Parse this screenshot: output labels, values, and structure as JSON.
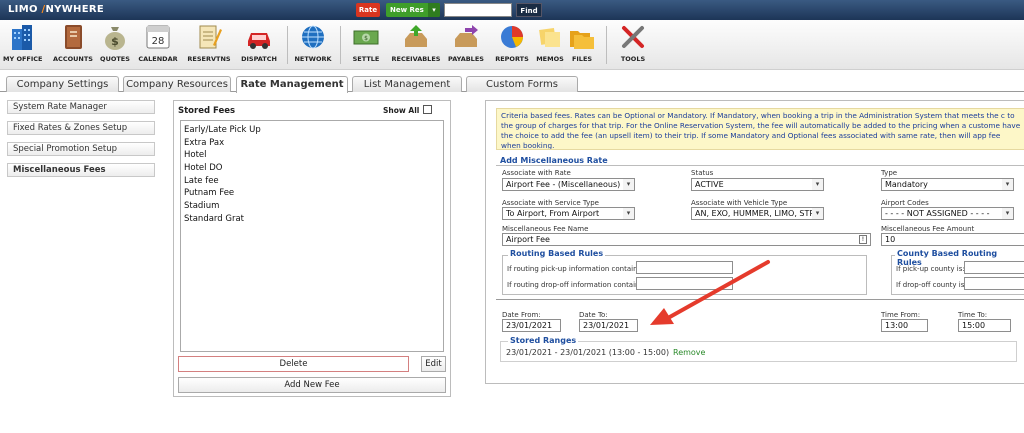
{
  "app": {
    "logo_text_a": "LIMO",
    "logo_text_b": "NYWHERE",
    "rate_label": "Rate",
    "new_res_label": "New Res",
    "new_res_caret": "▾",
    "search_value": "",
    "find_label": "Find"
  },
  "toolbar": {
    "items": [
      {
        "label": "MY OFFICE",
        "icon": "building-icon"
      },
      {
        "label": "ACCOUNTS",
        "icon": "ledger-book-icon"
      },
      {
        "label": "QUOTES",
        "icon": "money-bag-icon"
      },
      {
        "label": "CALENDAR",
        "icon": "calendar-icon"
      },
      {
        "label": "RESERVTNS",
        "icon": "notepad-pencil-icon"
      },
      {
        "label": "DISPATCH",
        "icon": "car-icon"
      },
      {
        "label": "NETWORK",
        "icon": "globe-icon"
      },
      {
        "label": "SETTLE",
        "icon": "cash-icon"
      },
      {
        "label": "RECEIVABLES",
        "icon": "inbox-tray-icon"
      },
      {
        "label": "PAYABLES",
        "icon": "outbox-tray-icon"
      },
      {
        "label": "REPORTS",
        "icon": "pie-chart-icon"
      },
      {
        "label": "MEMOS",
        "icon": "sticky-notes-icon"
      },
      {
        "label": "FILES",
        "icon": "folders-icon"
      },
      {
        "label": "TOOLS",
        "icon": "wrench-screwdriver-icon"
      }
    ],
    "calendar_day": "28"
  },
  "tabs": [
    {
      "label": "Company Settings",
      "active": false
    },
    {
      "label": "Company Resources",
      "active": false
    },
    {
      "label": "Rate Management",
      "active": true
    },
    {
      "label": "List Management",
      "active": false
    },
    {
      "label": "Custom Forms",
      "active": false
    }
  ],
  "nav": {
    "items": [
      {
        "label": "System Rate Manager",
        "active": false
      },
      {
        "label": "Fixed Rates & Zones Setup",
        "active": false
      },
      {
        "label": "Special Promotion Setup",
        "active": false
      },
      {
        "label": "Miscellaneous Fees",
        "active": true
      }
    ]
  },
  "stored_fees": {
    "title": "Stored Fees",
    "show_all_label": "Show All",
    "items": [
      "Early/Late Pick Up",
      "Extra Pax",
      "Hotel",
      "Hotel DO",
      "Late fee",
      "Putnam Fee",
      "Stadium",
      "Standard Grat"
    ],
    "delete_label": "Delete",
    "edit_label": "Edit",
    "add_label": "Add New Fee"
  },
  "criteria": {
    "text": "Criteria based fees. Rates can be Optional or Mandatory. If Mandatory, when booking a trip in the Administration System that meets the c to the group of charges for that trip. For the Online Reservation System, the fee will automatically be added to the pricing when a custome have the choice to add the fee (an upsell item) to their trip. If some Mandatory and Optional fees associated with same rate, then will app fee when booking."
  },
  "form": {
    "title": "Add Miscellaneous Rate",
    "associate_rate_label": "Associate with Rate",
    "associate_rate_value": "Airport Fee - (Miscellaneous)",
    "status_label": "Status",
    "status_value": "ACTIVE",
    "type_label": "Type",
    "type_value": "Mandatory",
    "service_type_label": "Associate with Service Type",
    "service_type_value": "To Airport, From Airport",
    "vehicle_type_label": "Associate with Vehicle Type",
    "vehicle_type_value": "AN, EXO, HUMMER, LIMO, STR",
    "airport_codes_label": "Airport Codes",
    "airport_codes_value": "- - - - NOT ASSIGNED - - - -",
    "fee_name_label": "Miscellaneous Fee Name",
    "fee_name_value": "Airport Fee",
    "fee_amount_label": "Miscellaneous Fee Amount",
    "fee_amount_value": "10",
    "routing_title": "Routing Based Rules",
    "routing_pickup_label": "If routing pick-up information contains:",
    "routing_dropoff_label": "If routing drop-off information contains:",
    "routing_pickup_value": "",
    "routing_dropoff_value": "",
    "county_title": "County Based Routing Rules",
    "county_pickup_label": "If pick-up county is:",
    "county_dropoff_label": "If drop-off county is:",
    "county_pickup_value": "",
    "county_dropoff_value": "",
    "date_from_label": "Date From:",
    "date_from_value": "23/01/2021",
    "date_to_label": "Date To:",
    "date_to_value": "23/01/2021",
    "time_from_label": "Time From:",
    "time_from_value": "13:00",
    "time_to_label": "Time To:",
    "time_to_value": "15:00",
    "stored_ranges_title": "Stored Ranges",
    "stored_range_value": "23/01/2021 - 23/01/2021 (13:00 - 15:00)",
    "stored_range_remove": "Remove"
  },
  "colors": {
    "accent_red": "#d9351f",
    "accent_green": "#3f9e2a",
    "link_blue": "#1f4fa0",
    "criteria_bg": "#fdf7c8",
    "arrow_red": "#e53b2c"
  }
}
